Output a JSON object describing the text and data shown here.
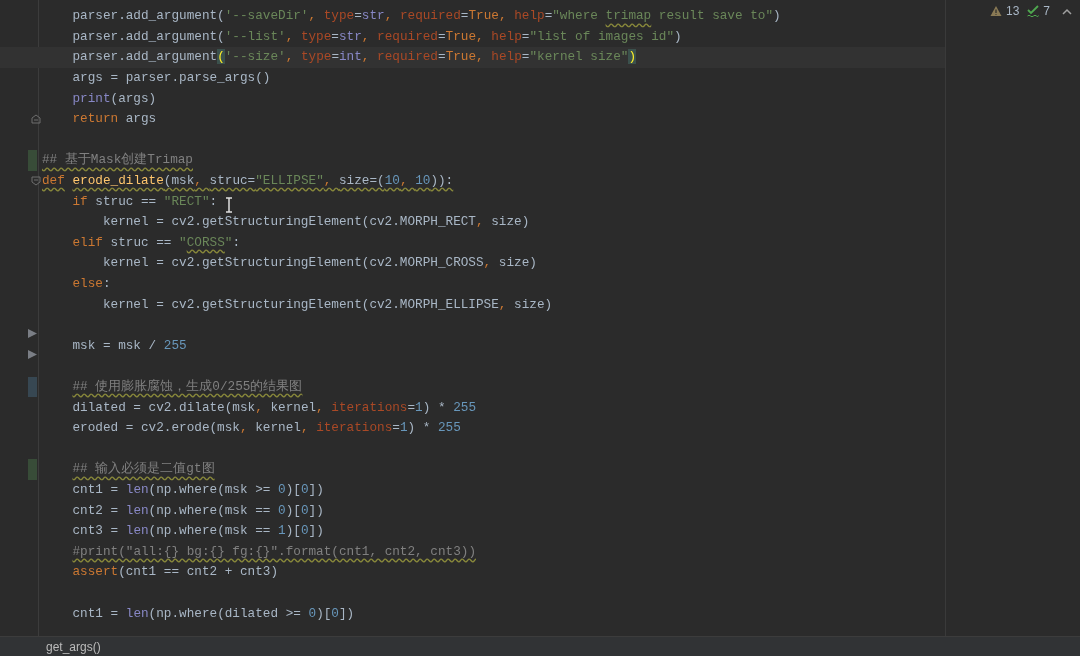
{
  "inspections": [
    {
      "kind": "warning",
      "count": "13"
    },
    {
      "kind": "typo",
      "count": "7"
    }
  ],
  "code_lines": [
    {
      "kind": "code",
      "tokens": [
        {
          "kind": "plain",
          "text": "    parser.add_argument("
        },
        {
          "kind": "str",
          "text": "'--saveDir'"
        },
        {
          "kind": "punct",
          "text": ", "
        },
        {
          "kind": "param",
          "text": "type"
        },
        {
          "kind": "plain",
          "text": "="
        },
        {
          "kind": "builtin",
          "text": "str"
        },
        {
          "kind": "punct",
          "text": ", "
        },
        {
          "kind": "param",
          "text": "required"
        },
        {
          "kind": "plain",
          "text": "="
        },
        {
          "kind": "kw",
          "text": "True"
        },
        {
          "kind": "punct",
          "text": ", "
        },
        {
          "kind": "param",
          "text": "help"
        },
        {
          "kind": "plain",
          "text": "="
        },
        {
          "kind": "str",
          "text": "\"where "
        },
        {
          "kind": "str",
          "text": "trimap",
          "typo": true
        },
        {
          "kind": "str",
          "text": " result save to\""
        },
        {
          "kind": "plain",
          "text": ")"
        }
      ]
    },
    {
      "kind": "code",
      "tokens": [
        {
          "kind": "plain",
          "text": "    parser.add_argument("
        },
        {
          "kind": "str",
          "text": "'--list'"
        },
        {
          "kind": "punct",
          "text": ", "
        },
        {
          "kind": "param",
          "text": "type"
        },
        {
          "kind": "plain",
          "text": "="
        },
        {
          "kind": "builtin",
          "text": "str"
        },
        {
          "kind": "punct",
          "text": ", "
        },
        {
          "kind": "param",
          "text": "required"
        },
        {
          "kind": "plain",
          "text": "="
        },
        {
          "kind": "kw",
          "text": "True"
        },
        {
          "kind": "punct",
          "text": ", "
        },
        {
          "kind": "param",
          "text": "help"
        },
        {
          "kind": "plain",
          "text": "="
        },
        {
          "kind": "str",
          "text": "\"list of images id\""
        },
        {
          "kind": "plain",
          "text": ")"
        }
      ]
    },
    {
      "kind": "code",
      "current": true,
      "tokens": [
        {
          "kind": "plain",
          "text": "    parser.add_argument"
        },
        {
          "kind": "match",
          "text": "("
        },
        {
          "kind": "str",
          "text": "'--size'"
        },
        {
          "kind": "punct",
          "text": ", "
        },
        {
          "kind": "param",
          "text": "type"
        },
        {
          "kind": "plain",
          "text": "="
        },
        {
          "kind": "builtin",
          "text": "int"
        },
        {
          "kind": "punct",
          "text": ", "
        },
        {
          "kind": "param",
          "text": "required"
        },
        {
          "kind": "plain",
          "text": "="
        },
        {
          "kind": "kw",
          "text": "True"
        },
        {
          "kind": "punct",
          "text": ", "
        },
        {
          "kind": "param",
          "text": "help"
        },
        {
          "kind": "plain",
          "text": "="
        },
        {
          "kind": "str",
          "text": "\"kernel size\""
        },
        {
          "kind": "match",
          "text": ")"
        }
      ]
    },
    {
      "kind": "code",
      "tokens": [
        {
          "kind": "plain",
          "text": "    args = parser.parse_args()"
        }
      ]
    },
    {
      "kind": "code",
      "tokens": [
        {
          "kind": "builtin",
          "text": "    print"
        },
        {
          "kind": "plain",
          "text": "(args)"
        }
      ]
    },
    {
      "kind": "code",
      "gutter_icon": {
        "kind": "fold-end"
      },
      "tokens": [
        {
          "kind": "kw",
          "text": "    return"
        },
        {
          "kind": "plain",
          "text": " args"
        }
      ]
    },
    {
      "kind": "blank"
    },
    {
      "kind": "code",
      "change": {
        "color": "#384c38"
      },
      "tokens": [
        {
          "kind": "comment",
          "text": "## 基于Mask创建Trimap",
          "typo": true
        }
      ]
    },
    {
      "kind": "code",
      "gutter_icon": {
        "kind": "fold-start"
      },
      "tokens": [
        {
          "kind": "kw",
          "text": "def",
          "typo": true
        },
        {
          "kind": "fn",
          "text": " erode_dilate",
          "typo": true
        },
        {
          "kind": "plain",
          "text": "(msk",
          "typo": true
        },
        {
          "kind": "punct",
          "text": ", ",
          "typo": true
        },
        {
          "kind": "plain",
          "text": "struc=",
          "typo": true
        },
        {
          "kind": "str",
          "text": "\"ELLIPSE\"",
          "typo": true
        },
        {
          "kind": "punct",
          "text": ", ",
          "typo": true
        },
        {
          "kind": "plain",
          "text": "size=(",
          "typo": true
        },
        {
          "kind": "num",
          "text": "10",
          "typo": true
        },
        {
          "kind": "punct",
          "text": ", ",
          "typo": true
        },
        {
          "kind": "num",
          "text": "10",
          "typo": true
        },
        {
          "kind": "plain",
          "text": ")):",
          "typo": true
        }
      ]
    },
    {
      "kind": "code",
      "tokens": [
        {
          "kind": "kw",
          "text": "    if"
        },
        {
          "kind": "plain",
          "text": " struc == "
        },
        {
          "kind": "str",
          "text": "\"RECT\""
        },
        {
          "kind": "plain",
          "text": ":"
        }
      ]
    },
    {
      "kind": "code",
      "tokens": [
        {
          "kind": "plain",
          "text": "        kernel = cv2.getStructuringElement(cv2.MORPH_RECT"
        },
        {
          "kind": "punct",
          "text": ", "
        },
        {
          "kind": "plain",
          "text": "size)"
        }
      ]
    },
    {
      "kind": "code",
      "tokens": [
        {
          "kind": "kw",
          "text": "    elif"
        },
        {
          "kind": "plain",
          "text": " struc == "
        },
        {
          "kind": "str",
          "text": "\""
        },
        {
          "kind": "str",
          "text": "CORSS",
          "typo": true
        },
        {
          "kind": "str",
          "text": "\""
        },
        {
          "kind": "plain",
          "text": ":"
        }
      ]
    },
    {
      "kind": "code",
      "tokens": [
        {
          "kind": "plain",
          "text": "        kernel = cv2.getStructuringElement(cv2.MORPH_CROSS"
        },
        {
          "kind": "punct",
          "text": ", "
        },
        {
          "kind": "plain",
          "text": "size)"
        }
      ]
    },
    {
      "kind": "code",
      "tokens": [
        {
          "kind": "kw",
          "text": "    else"
        },
        {
          "kind": "plain",
          "text": ":"
        }
      ]
    },
    {
      "kind": "code",
      "tokens": [
        {
          "kind": "plain",
          "text": "        kernel = cv2.getStructuringElement(cv2.MORPH_ELLIPSE"
        },
        {
          "kind": "punct",
          "text": ", "
        },
        {
          "kind": "plain",
          "text": "size)"
        }
      ]
    },
    {
      "kind": "blank",
      "gutter_icon": {
        "kind": "arrow"
      }
    },
    {
      "kind": "code",
      "gutter_icon": {
        "kind": "arrow"
      },
      "tokens": [
        {
          "kind": "plain",
          "text": "    msk = msk / "
        },
        {
          "kind": "num",
          "text": "255"
        }
      ]
    },
    {
      "kind": "blank"
    },
    {
      "kind": "code",
      "change": {
        "color": "#374752"
      },
      "tokens": [
        {
          "kind": "comment",
          "text": "    ## 使用膨胀腐蚀，生成0/255的结果图",
          "typo": true
        }
      ]
    },
    {
      "kind": "code",
      "tokens": [
        {
          "kind": "plain",
          "text": "    dilated = cv2.dilate(msk"
        },
        {
          "kind": "punct",
          "text": ", "
        },
        {
          "kind": "plain",
          "text": "kernel"
        },
        {
          "kind": "punct",
          "text": ", "
        },
        {
          "kind": "param",
          "text": "iterations"
        },
        {
          "kind": "plain",
          "text": "="
        },
        {
          "kind": "num",
          "text": "1"
        },
        {
          "kind": "plain",
          "text": ") * "
        },
        {
          "kind": "num",
          "text": "255"
        }
      ]
    },
    {
      "kind": "code",
      "tokens": [
        {
          "kind": "plain",
          "text": "    eroded = cv2.erode(msk"
        },
        {
          "kind": "punct",
          "text": ", "
        },
        {
          "kind": "plain",
          "text": "kernel"
        },
        {
          "kind": "punct",
          "text": ", "
        },
        {
          "kind": "param",
          "text": "iterations"
        },
        {
          "kind": "plain",
          "text": "="
        },
        {
          "kind": "num",
          "text": "1"
        },
        {
          "kind": "plain",
          "text": ") * "
        },
        {
          "kind": "num",
          "text": "255"
        }
      ]
    },
    {
      "kind": "blank"
    },
    {
      "kind": "code",
      "change": {
        "color": "#384c38"
      },
      "tokens": [
        {
          "kind": "comment",
          "text": "    ## 输入必须是二值gt图",
          "typo": true
        }
      ]
    },
    {
      "kind": "code",
      "tokens": [
        {
          "kind": "plain",
          "text": "    cnt1 = "
        },
        {
          "kind": "builtin",
          "text": "len"
        },
        {
          "kind": "plain",
          "text": "(np.where(msk >= "
        },
        {
          "kind": "num",
          "text": "0"
        },
        {
          "kind": "plain",
          "text": ")["
        },
        {
          "kind": "num",
          "text": "0"
        },
        {
          "kind": "plain",
          "text": "])"
        }
      ]
    },
    {
      "kind": "code",
      "tokens": [
        {
          "kind": "plain",
          "text": "    cnt2 = "
        },
        {
          "kind": "builtin",
          "text": "len"
        },
        {
          "kind": "plain",
          "text": "(np.where(msk == "
        },
        {
          "kind": "num",
          "text": "0"
        },
        {
          "kind": "plain",
          "text": ")["
        },
        {
          "kind": "num",
          "text": "0"
        },
        {
          "kind": "plain",
          "text": "])"
        }
      ]
    },
    {
      "kind": "code",
      "tokens": [
        {
          "kind": "plain",
          "text": "    cnt3 = "
        },
        {
          "kind": "builtin",
          "text": "len"
        },
        {
          "kind": "plain",
          "text": "(np.where(msk == "
        },
        {
          "kind": "num",
          "text": "1"
        },
        {
          "kind": "plain",
          "text": ")["
        },
        {
          "kind": "num",
          "text": "0"
        },
        {
          "kind": "plain",
          "text": "])"
        }
      ]
    },
    {
      "kind": "code",
      "tokens": [
        {
          "kind": "comment",
          "text": "    #print(\"all:{} bg:{} fg:{}\".format(cnt1, cnt2, cnt3))",
          "typo": true
        }
      ]
    },
    {
      "kind": "code",
      "tokens": [
        {
          "kind": "kw",
          "text": "    assert"
        },
        {
          "kind": "plain",
          "text": "(cnt1 == cnt2 + cnt3)"
        }
      ]
    },
    {
      "kind": "blank"
    },
    {
      "kind": "code",
      "tokens": [
        {
          "kind": "plain",
          "text": "    cnt1 = "
        },
        {
          "kind": "builtin",
          "text": "len"
        },
        {
          "kind": "plain",
          "text": "(np.where(dilated >= "
        },
        {
          "kind": "num",
          "text": "0"
        },
        {
          "kind": "plain",
          "text": ")["
        },
        {
          "kind": "num",
          "text": "0"
        },
        {
          "kind": "plain",
          "text": "])"
        }
      ]
    }
  ],
  "breadcrumb": "get_args()"
}
